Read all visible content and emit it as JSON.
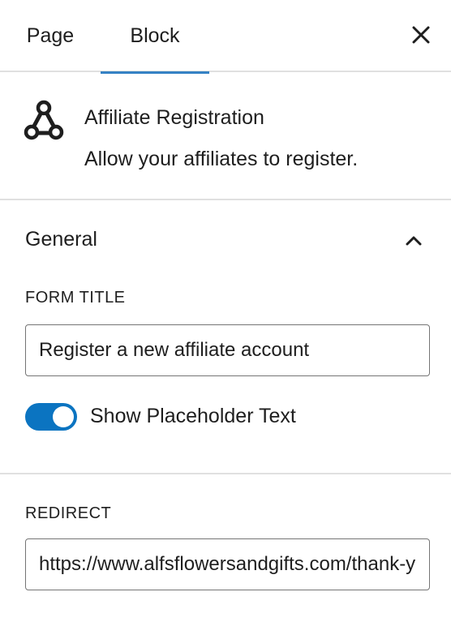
{
  "tabs": [
    {
      "label": "Page",
      "active": false
    },
    {
      "label": "Block",
      "active": true
    }
  ],
  "block": {
    "title": "Affiliate Registration",
    "description": "Allow your affiliates to register.",
    "icon": "affiliate-network-icon"
  },
  "general": {
    "title": "General",
    "expanded": true,
    "form_title_label": "FORM TITLE",
    "form_title_value": "Register a new affiliate account",
    "toggle_label": "Show Placeholder Text",
    "toggle_on": true
  },
  "redirect": {
    "label": "REDIRECT",
    "value": "https://www.alfsflowersandgifts.com/thank-you"
  },
  "colors": {
    "accent": "#3582c4",
    "toggle": "#0b74c1",
    "divider": "#e0e0e0"
  }
}
